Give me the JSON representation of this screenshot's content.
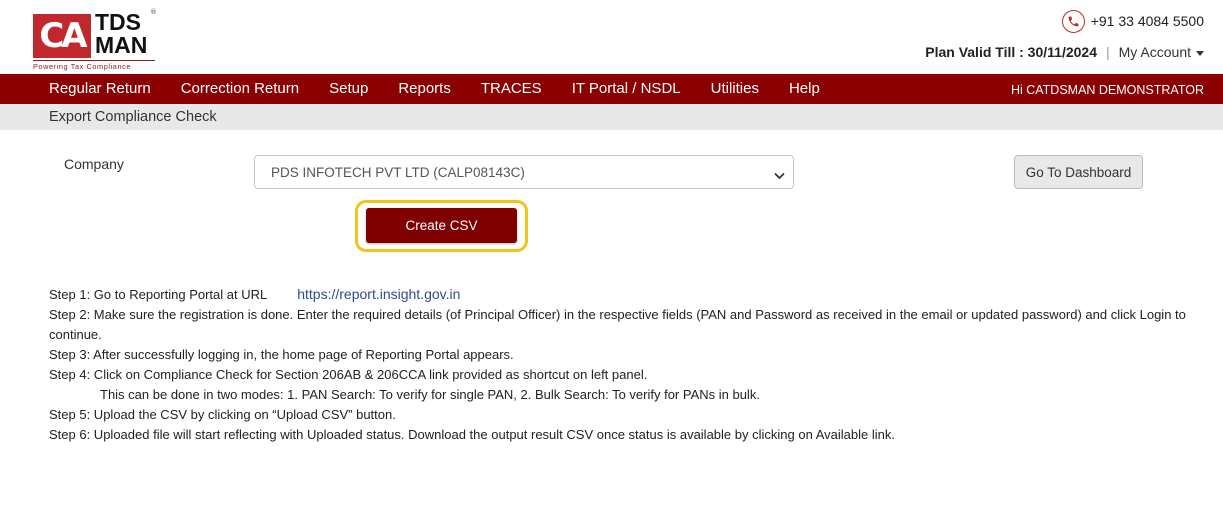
{
  "header": {
    "logo": {
      "mark": "CA",
      "word1": "TDS",
      "word2": "MAN",
      "registered": "®",
      "tagline": "Powering Tax Compliance"
    },
    "phone": "+91 33 4084 5500",
    "plan_valid": "Plan Valid Till : 30/11/2024",
    "separator": "|",
    "my_account": "My Account"
  },
  "nav": {
    "items": [
      {
        "label": "Regular Return"
      },
      {
        "label": "Correction Return"
      },
      {
        "label": "Setup"
      },
      {
        "label": "Reports"
      },
      {
        "label": "TRACES"
      },
      {
        "label": "IT Portal / NSDL"
      },
      {
        "label": "Utilities"
      },
      {
        "label": "Help"
      }
    ],
    "greeting": "Hi CATDSMAN DEMONSTRATOR"
  },
  "breadcrumb": "Export Compliance Check",
  "form": {
    "company_label": "Company",
    "company_selected": "PDS INFOTECH PVT LTD (CALP08143C)",
    "dashboard_button": "Go To Dashboard",
    "create_csv_button": "Create CSV"
  },
  "steps": {
    "step1_text": "Step 1: Go to Reporting Portal at URL",
    "step1_link": "https://report.insight.gov.in",
    "step2": "Step 2: Make sure the registration is done. Enter the required details (of Principal Officer) in the respective fields (PAN and Password as received in the email or updated password) and click Login to continue.",
    "step3": "Step 3: After successfully logging in, the home page of Reporting Portal appears.",
    "step4": "Step 4: Click on Compliance Check for Section 206AB & 206CCA link provided as shortcut on left panel.",
    "step4_detail": "This can be done in two modes: 1. PAN Search: To verify for single PAN, 2. Bulk Search: To verify for PANs in bulk.",
    "step5": "Step 5: Upload the CSV by clicking on “Upload CSV” button.",
    "step6": "Step 6: Uploaded file will start reflecting with Uploaded status. Download the output result CSV once status is available by clicking on Available link."
  },
  "colors": {
    "brand_red": "#c0282d",
    "nav_bg": "#8b0000",
    "button_maroon": "#800000",
    "highlight": "#f2c319",
    "link": "#2a4d8f"
  },
  "icons": {
    "phone": "phone-icon",
    "dropdown": "chevron-down-icon",
    "account_caret": "caret-down-icon"
  }
}
